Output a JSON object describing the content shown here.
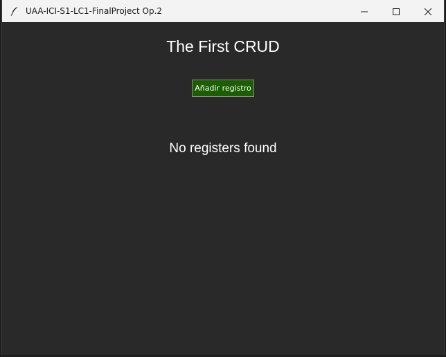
{
  "window": {
    "title": "UAA-ICI-S1-LC1-FinalProject Op.2",
    "app_icon": "feather-icon",
    "controls": [
      "minimize-icon",
      "maximize-icon",
      "close-icon"
    ]
  },
  "main": {
    "heading": "The First CRUD",
    "add_button_label": "Añadir registro",
    "empty_message": "No registers found"
  },
  "colors": {
    "background": "#292929",
    "titlebar": "#f3f3f3",
    "button_bg": "#1b5e00",
    "text": "#ffffff"
  }
}
